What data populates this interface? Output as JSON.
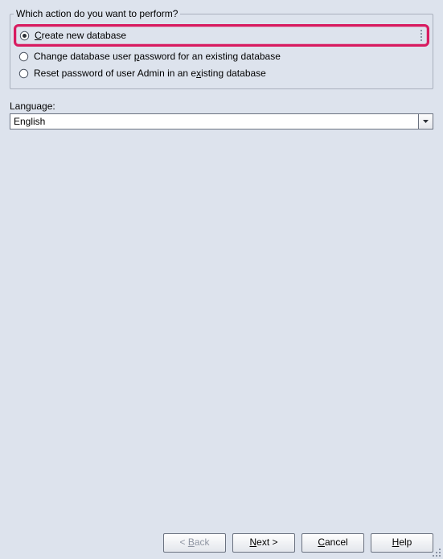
{
  "group": {
    "legend": "Which action do you want to perform?",
    "options": [
      {
        "id": "create",
        "label_pre": "",
        "label_mn": "C",
        "label_post": "reate new database",
        "selected": true
      },
      {
        "id": "changepw",
        "label_pre": "Change database user ",
        "label_mn": "p",
        "label_post": "assword for an existing database",
        "selected": false
      },
      {
        "id": "resetpw",
        "label_pre": "Reset password of user Admin in an e",
        "label_mn": "x",
        "label_post": "isting database",
        "selected": false
      }
    ]
  },
  "language": {
    "label": "Language:",
    "value": "English"
  },
  "buttons": {
    "back": {
      "pre": "< ",
      "mn": "B",
      "post": "ack"
    },
    "next": {
      "pre": "",
      "mn": "N",
      "post": "ext >"
    },
    "cancel": {
      "pre": "",
      "mn": "C",
      "post": "ancel"
    },
    "help": {
      "pre": "",
      "mn": "H",
      "post": "elp"
    }
  }
}
